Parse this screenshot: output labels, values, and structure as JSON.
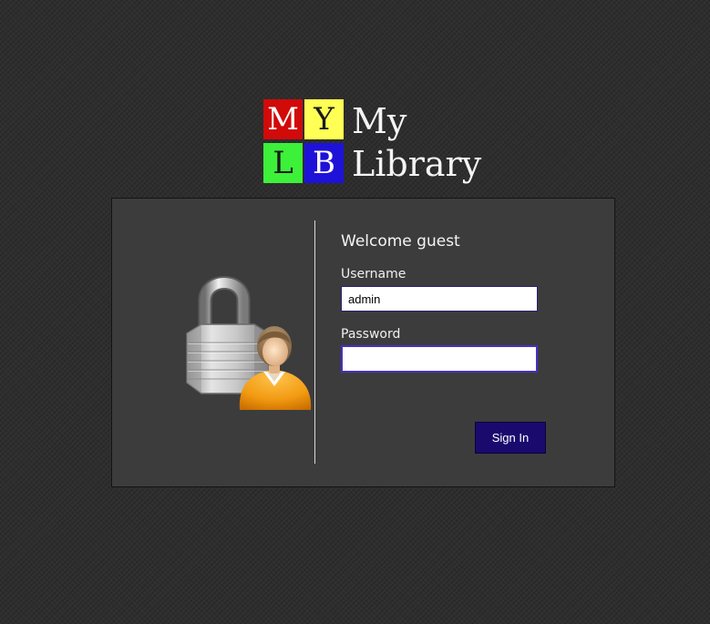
{
  "logo": {
    "tiles": [
      "M",
      "Y",
      "L",
      "B"
    ],
    "word_line1": "My",
    "word_line2": "Library",
    "colors": {
      "tile_m": "#d10a0a",
      "tile_y": "#ffff55",
      "tile_l": "#3df03a",
      "tile_b": "#1f12d8"
    }
  },
  "login": {
    "image_icon": "padlock-user-icon",
    "welcome": "Welcome guest",
    "username_label": "Username",
    "username_value": "admin",
    "password_label": "Password",
    "password_value": "",
    "signin_label": "Sign In"
  },
  "colors": {
    "background": "#2e2e2e",
    "panel": "#3c3c3c",
    "button": "#1a0a6e",
    "focus_border": "#4b2dc6"
  }
}
